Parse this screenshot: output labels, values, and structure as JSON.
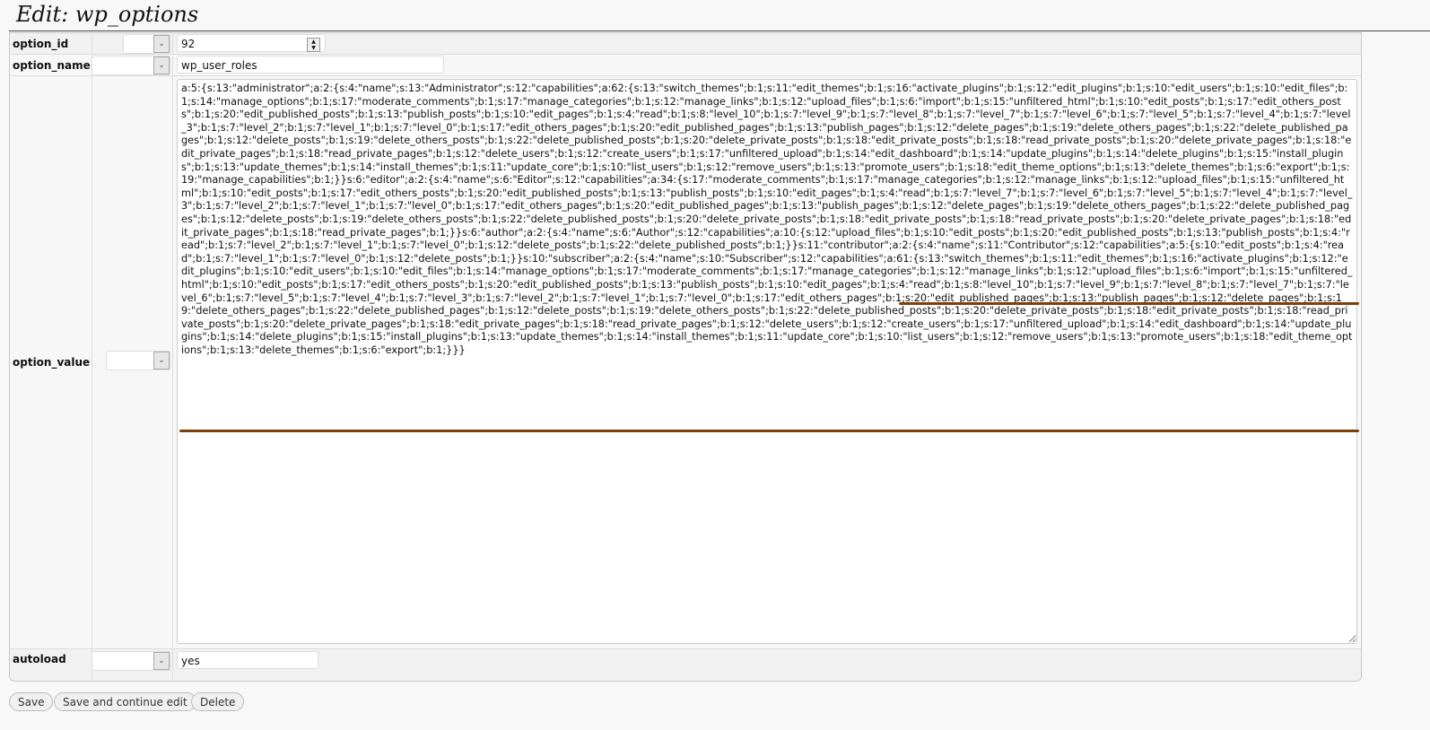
{
  "title": "Edit: wp_options",
  "fields": [
    {
      "label": "option_id",
      "value": "92"
    },
    {
      "label": "option_name",
      "value": "wp_user_roles"
    },
    {
      "label": "option_value",
      "value": "a:5:{s:13:\"administrator\";a:2:{s:4:\"name\";s:13:\"Administrator\";s:12:\"capabilities\";a:62:{s:13:\"switch_themes\";b:1;s:11:\"edit_themes\";b:1;s:16:\"activate_plugins\";b:1;s:12:\"edit_plugins\";b:1;s:10:\"edit_users\";b:1;s:10:\"edit_files\";b:1;s:14:\"manage_options\";b:1;s:17:\"moderate_comments\";b:1;s:17:\"manage_categories\";b:1;s:12:\"manage_links\";b:1;s:12:\"upload_files\";b:1;s:6:\"import\";b:1;s:15:\"unfiltered_html\";b:1;s:10:\"edit_posts\";b:1;s:17:\"edit_others_posts\";b:1;s:20:\"edit_published_posts\";b:1;s:13:\"publish_posts\";b:1;s:10:\"edit_pages\";b:1;s:4:\"read\";b:1;s:8:\"level_10\";b:1;s:7:\"level_9\";b:1;s:7:\"level_8\";b:1;s:7:\"level_7\";b:1;s:7:\"level_6\";b:1;s:7:\"level_5\";b:1;s:7:\"level_4\";b:1;s:7:\"level_3\";b:1;s:7:\"level_2\";b:1;s:7:\"level_1\";b:1;s:7:\"level_0\";b:1;s:17:\"edit_others_pages\";b:1;s:20:\"edit_published_pages\";b:1;s:13:\"publish_pages\";b:1;s:12:\"delete_pages\";b:1;s:19:\"delete_others_pages\";b:1;s:22:\"delete_published_pages\";b:1;s:12:\"delete_posts\";b:1;s:19:\"delete_others_posts\";b:1;s:22:\"delete_published_posts\";b:1;s:20:\"delete_private_posts\";b:1;s:18:\"edit_private_posts\";b:1;s:18:\"read_private_posts\";b:1;s:20:\"delete_private_pages\";b:1;s:18:\"edit_private_pages\";b:1;s:18:\"read_private_pages\";b:1;s:12:\"delete_users\";b:1;s:12:\"create_users\";b:1;s:17:\"unfiltered_upload\";b:1;s:14:\"edit_dashboard\";b:1;s:14:\"update_plugins\";b:1;s:14:\"delete_plugins\";b:1;s:15:\"install_plugins\";b:1;s:13:\"update_themes\";b:1;s:14:\"install_themes\";b:1;s:11:\"update_core\";b:1;s:10:\"list_users\";b:1;s:12:\"remove_users\";b:1;s:13:\"promote_users\";b:1;s:18:\"edit_theme_options\";b:1;s:13:\"delete_themes\";b:1;s:6:\"export\";b:1;s:19:\"manage_capabilities\";b:1;}}s:6:\"editor\";a:2:{s:4:\"name\";s:6:\"Editor\";s:12:\"capabilities\";a:34:{s:17:\"moderate_comments\";b:1;s:17:\"manage_categories\";b:1;s:12:\"manage_links\";b:1;s:12:\"upload_files\";b:1;s:15:\"unfiltered_html\";b:1;s:10:\"edit_posts\";b:1;s:17:\"edit_others_posts\";b:1;s:20:\"edit_published_posts\";b:1;s:13:\"publish_posts\";b:1;s:10:\"edit_pages\";b:1;s:4:\"read\";b:1;s:7:\"level_7\";b:1;s:7:\"level_6\";b:1;s:7:\"level_5\";b:1;s:7:\"level_4\";b:1;s:7:\"level_3\";b:1;s:7:\"level_2\";b:1;s:7:\"level_1\";b:1;s:7:\"level_0\";b:1;s:17:\"edit_others_pages\";b:1;s:20:\"edit_published_pages\";b:1;s:13:\"publish_pages\";b:1;s:12:\"delete_pages\";b:1;s:19:\"delete_others_pages\";b:1;s:22:\"delete_published_pages\";b:1;s:12:\"delete_posts\";b:1;s:19:\"delete_others_posts\";b:1;s:22:\"delete_published_posts\";b:1;s:20:\"delete_private_posts\";b:1;s:18:\"edit_private_posts\";b:1;s:18:\"read_private_posts\";b:1;s:20:\"delete_private_pages\";b:1;s:18:\"edit_private_pages\";b:1;s:18:\"read_private_pages\";b:1;}}s:6:\"author\";a:2:{s:4:\"name\";s:6:\"Author\";s:12:\"capabilities\";a:10:{s:12:\"upload_files\";b:1;s:10:\"edit_posts\";b:1;s:20:\"edit_published_posts\";b:1;s:13:\"publish_posts\";b:1;s:4:\"read\";b:1;s:7:\"level_2\";b:1;s:7:\"level_1\";b:1;s:7:\"level_0\";b:1;s:12:\"delete_posts\";b:1;s:22:\"delete_published_posts\";b:1;}}s:11:\"contributor\";a:2:{s:4:\"name\";s:11:\"Contributor\";s:12:\"capabilities\";a:5:{s:10:\"edit_posts\";b:1;s:4:\"read\";b:1;s:7:\"level_1\";b:1;s:7:\"level_0\";b:1;s:12:\"delete_posts\";b:1;}}s:10:\"subscriber\";a:2:{s:4:\"name\";s:10:\"Subscriber\";s:12:\"capabilities\";a:61:{s:13:\"switch_themes\";b:1;s:11:\"edit_themes\";b:1;s:16:\"activate_plugins\";b:1;s:12:\"edit_plugins\";b:1;s:10:\"edit_users\";b:1;s:10:\"edit_files\";b:1;s:14:\"manage_options\";b:1;s:17:\"moderate_comments\";b:1;s:17:\"manage_categories\";b:1;s:12:\"manage_links\";b:1;s:12:\"upload_files\";b:1;s:6:\"import\";b:1;s:15:\"unfiltered_html\";b:1;s:10:\"edit_posts\";b:1;s:17:\"edit_others_posts\";b:1;s:20:\"edit_published_posts\";b:1;s:13:\"publish_posts\";b:1;s:10:\"edit_pages\";b:1;s:4:\"read\";b:1;s:8:\"level_10\";b:1;s:7:\"level_9\";b:1;s:7:\"level_8\";b:1;s:7:\"level_7\";b:1;s:7:\"level_6\";b:1;s:7:\"level_5\";b:1;s:7:\"level_4\";b:1;s:7:\"level_3\";b:1;s:7:\"level_2\";b:1;s:7:\"level_1\";b:1;s:7:\"level_0\";b:1;s:17:\"edit_others_pages\";b:1;s:20:\"edit_published_pages\";b:1;s:13:\"publish_pages\";b:1;s:12:\"delete_pages\";b:1;s:19:\"delete_others_pages\";b:1;s:22:\"delete_published_pages\";b:1;s:12:\"delete_posts\";b:1;s:19:\"delete_others_posts\";b:1;s:22:\"delete_published_posts\";b:1;s:20:\"delete_private_posts\";b:1;s:18:\"edit_private_posts\";b:1;s:18:\"read_private_posts\";b:1;s:20:\"delete_private_pages\";b:1;s:18:\"edit_private_pages\";b:1;s:18:\"read_private_pages\";b:1;s:12:\"delete_users\";b:1;s:12:\"create_users\";b:1;s:17:\"unfiltered_upload\";b:1;s:14:\"edit_dashboard\";b:1;s:14:\"update_plugins\";b:1;s:14:\"delete_plugins\";b:1;s:15:\"install_plugins\";b:1;s:13:\"update_themes\";b:1;s:14:\"install_themes\";b:1;s:11:\"update_core\";b:1;s:10:\"list_users\";b:1;s:12:\"remove_users\";b:1;s:13:\"promote_users\";b:1;s:18:\"edit_theme_options\";b:1;s:13:\"delete_themes\";b:1;s:6:\"export\";b:1;}}}"
    },
    {
      "label": "autoload",
      "value": "yes"
    }
  ],
  "buttons": {
    "save": "Save",
    "save_continue": "Save and continue edit",
    "delete": "Delete"
  },
  "icons": {
    "select": "chevron-down-icon",
    "spinner": "spin-arrows-icon"
  },
  "colors": {
    "annotation": "#7a3f0a"
  }
}
